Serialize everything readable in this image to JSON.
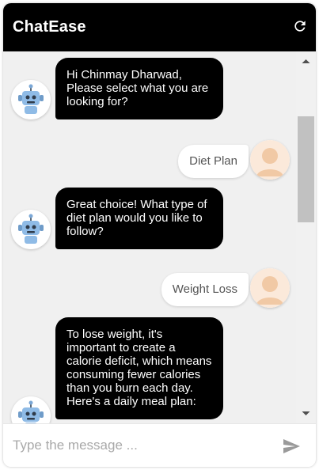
{
  "app": {
    "title": "ChatEase"
  },
  "header": {
    "refresh_icon": "refresh-icon"
  },
  "messages": [
    {
      "sender": "bot",
      "text": "Hi Chinmay Dharwad, Please select what you are looking for?"
    },
    {
      "sender": "user",
      "text": "Diet Plan"
    },
    {
      "sender": "bot",
      "text": "Great choice! What type of diet plan would you like to follow?"
    },
    {
      "sender": "user",
      "text": "Weight Loss"
    },
    {
      "sender": "bot",
      "text": "To lose weight, it's important to create a calorie deficit, which means consuming fewer calories than you burn each day. Here's a daily meal plan:"
    }
  ],
  "composer": {
    "placeholder": "Type the message ...",
    "send_icon": "send-icon"
  },
  "colors": {
    "header_bg": "#000000",
    "bot_bubble": "#000000",
    "user_bubble": "#ffffff",
    "background": "#f0f0f0"
  }
}
